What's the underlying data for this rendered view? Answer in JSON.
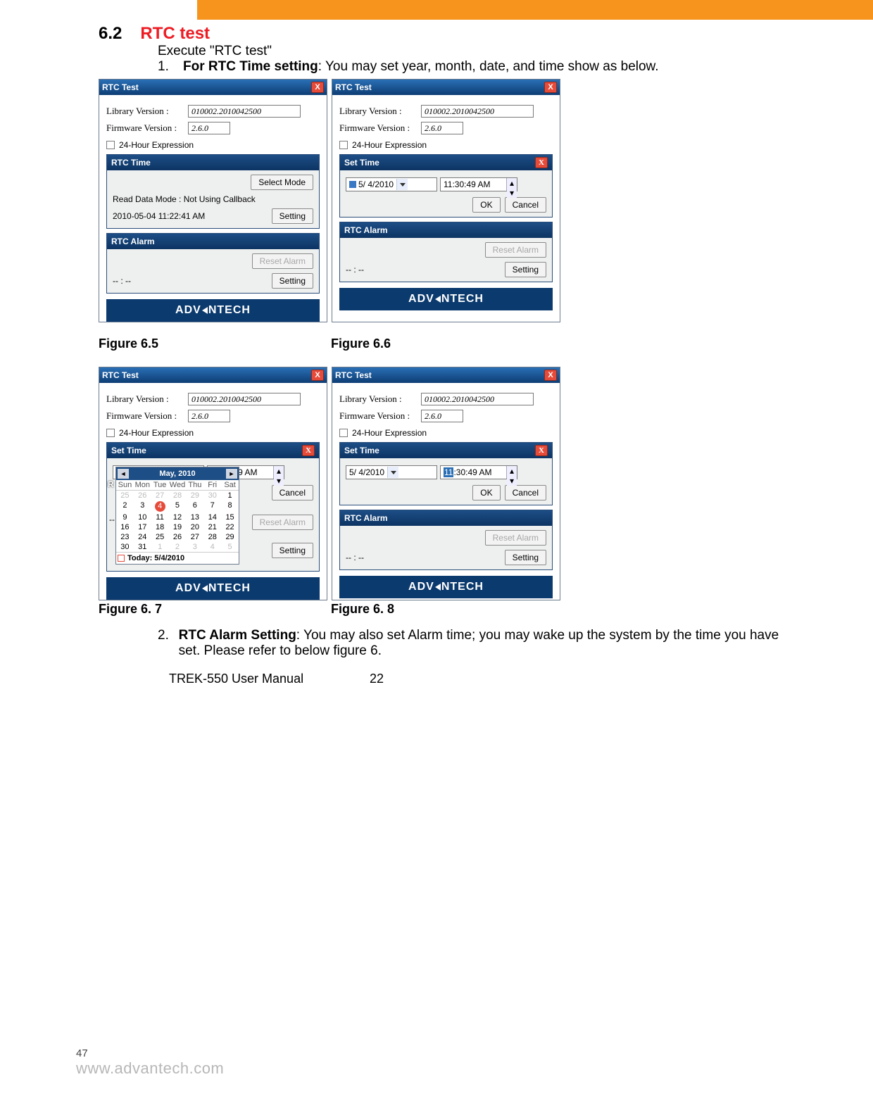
{
  "section": {
    "number": "6.2",
    "title": "RTC test"
  },
  "intro": "Execute \"RTC test\"",
  "li1": {
    "n": "1.",
    "bold": "For RTC Time setting",
    "rest": ": You may set year, month, date, and time show as below."
  },
  "li2": {
    "n": "2.",
    "bold": "RTC Alarm Setting",
    "rest": ": You may also set Alarm time; you may wake up the system by the time you have set. Please refer to below figure 6."
  },
  "captions": {
    "f5": "Figure 6.5",
    "f6": "Figure 6.6",
    "f7": "Figure 6. 7",
    "f8": "Figure 6. 8"
  },
  "common": {
    "win_title": "RTC Test",
    "lib_label": "Library Version :",
    "lib_val": "010002.2010042500",
    "fw_label": "Firmware Version :",
    "fw_val": "2.6.0",
    "chk_label": "24-Hour Expression",
    "rtc_time_title": "RTC Time",
    "rtc_alarm_title": "RTC Alarm",
    "alarm_value": "-- : --",
    "select_mode": "Select Mode",
    "read_mode": "Read Data Mode : Not Using Callback",
    "timestamp": "2010-05-04 11:22:41 AM",
    "setting": "Setting",
    "reset_alarm": "Reset Alarm",
    "set_time_title": "Set Time",
    "ok": "OK",
    "cancel": "Cancel",
    "date_val": "5/ 4/2010",
    "time_val": "11:30:49 AM",
    "time_sel_hh": "11",
    "time_sel_rest": ":30:49 AM",
    "logo": "ADV NTECH",
    "close": "X"
  },
  "cal": {
    "month": "May, 2010",
    "dow": [
      "Sun",
      "Mon",
      "Tue",
      "Wed",
      "Thu",
      "Fri",
      "Sat"
    ],
    "prefix_out": [
      "25",
      "26",
      "27",
      "28",
      "29",
      "30"
    ],
    "days": [
      "1",
      "2",
      "3",
      "4",
      "5",
      "6",
      "7",
      "8",
      "9",
      "10",
      "11",
      "12",
      "13",
      "14",
      "15",
      "16",
      "17",
      "18",
      "19",
      "20",
      "21",
      "22",
      "23",
      "24",
      "25",
      "26",
      "27",
      "28",
      "29",
      "30",
      "31"
    ],
    "suffix_out": [
      "1",
      "2",
      "3",
      "4",
      "5"
    ],
    "selected": "4",
    "today_label": "Today: 5/4/2010"
  },
  "footer": {
    "manual": "TREK-550 User Manual",
    "pg": "22"
  },
  "corner": {
    "pagenum": "47",
    "url": "www.advantech.com"
  }
}
